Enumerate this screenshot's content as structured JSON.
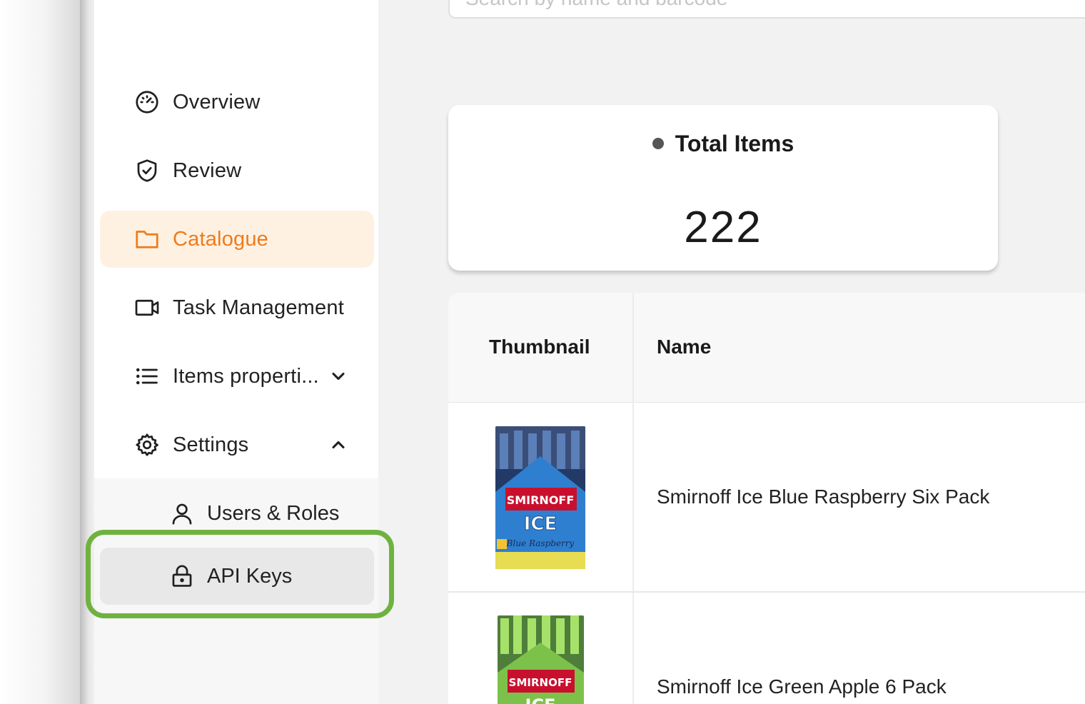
{
  "search": {
    "placeholder": "Search by name and barcode"
  },
  "sidebar": {
    "items": [
      {
        "label": "Overview",
        "icon": "gauge-icon"
      },
      {
        "label": "Review",
        "icon": "shield-check-icon"
      },
      {
        "label": "Catalogue",
        "icon": "folder-icon",
        "active": true
      },
      {
        "label": "Task Management",
        "icon": "video-camera-icon"
      },
      {
        "label": "Items properti...",
        "icon": "list-icon",
        "expandable": "collapsed"
      },
      {
        "label": "Settings",
        "icon": "gear-icon",
        "expandable": "expanded"
      }
    ],
    "settings_sub": [
      {
        "label": "Users & Roles",
        "icon": "user-icon"
      },
      {
        "label": "API Keys",
        "icon": "lock-icon",
        "selected": true
      }
    ]
  },
  "stat": {
    "title": "Total Items",
    "value": "222"
  },
  "table": {
    "columns": [
      "Thumbnail",
      "Name"
    ],
    "rows": [
      {
        "name": "Smirnoff Ice Blue Raspberry Six Pack",
        "thumb_brand": "SMIRNOFF",
        "thumb_product": "ICE",
        "thumb_flavor": "Blue Raspberry",
        "thumb_color": "#2f7fd1"
      },
      {
        "name": "Smirnoff Ice Green Apple 6 Pack",
        "thumb_brand": "SMIRNOFF",
        "thumb_product": "ICE",
        "thumb_color": "#7cc24a"
      }
    ]
  },
  "colors": {
    "accent": "#f07a1a",
    "active_bg": "#fff1e2",
    "highlight": "#6fb23f"
  }
}
